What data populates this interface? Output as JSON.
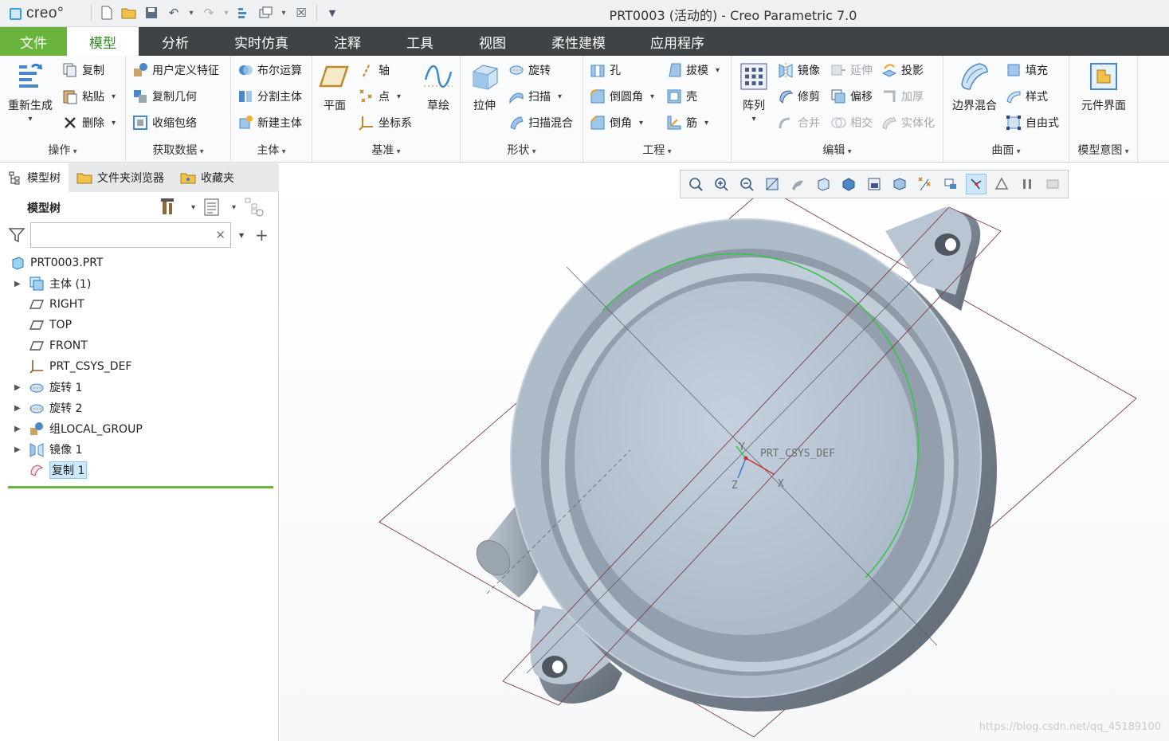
{
  "app": {
    "logo_text": "creo°",
    "window_title": "PRT0003 (活动的) - Creo Parametric 7.0"
  },
  "menu": {
    "tabs": [
      "文件",
      "模型",
      "分析",
      "实时仿真",
      "注释",
      "工具",
      "视图",
      "柔性建模",
      "应用程序"
    ],
    "active": "模型"
  },
  "ribbon": {
    "operations": {
      "label": "操作",
      "regenerate": "重新生成",
      "copy": "复制",
      "paste": "粘贴",
      "delete": "删除"
    },
    "get_data": {
      "label": "获取数据",
      "udf": "用户定义特征",
      "copy_geom": "复制几何",
      "shrinkwrap": "收缩包络"
    },
    "body": {
      "label": "主体",
      "boolean": "布尔运算",
      "split": "分割主体",
      "new_body": "新建主体"
    },
    "datum": {
      "label": "基准",
      "plane": "平面",
      "axis": "轴",
      "point": "点",
      "csys": "坐标系",
      "sketch": "草绘"
    },
    "shapes": {
      "label": "形状",
      "extrude": "拉伸",
      "revolve": "旋转",
      "sweep": "扫描",
      "swept_blend": "扫描混合"
    },
    "engineering": {
      "label": "工程",
      "hole": "孔",
      "round": "倒圆角",
      "chamfer": "倒角",
      "draft": "拔模",
      "shell": "壳",
      "rib": "筋"
    },
    "editing": {
      "label": "编辑",
      "pattern": "阵列",
      "mirror": "镜像",
      "trim": "修剪",
      "merge": "合并",
      "extend": "延伸",
      "offset": "偏移",
      "intersect": "相交",
      "project": "投影",
      "thicken": "加厚",
      "solidify": "实体化"
    },
    "surfaces": {
      "label": "曲面",
      "boundary_blend": "边界混合",
      "fill": "填充",
      "style": "样式",
      "freestyle": "自由式"
    },
    "model_intent": {
      "label": "模型意图",
      "component_interface": "元件界面"
    }
  },
  "panel": {
    "tabs": [
      "模型树",
      "文件夹浏览器",
      "收藏夹"
    ],
    "tree_header": "模型树",
    "search_value": "",
    "tree": [
      {
        "label": "PRT0003.PRT",
        "icon": "part-icon",
        "expand": false,
        "selected": false
      },
      {
        "label": "主体 (1)",
        "icon": "body-icon",
        "expand": true,
        "selected": false
      },
      {
        "label": "RIGHT",
        "icon": "datum-plane-icon",
        "expand": false,
        "selected": false
      },
      {
        "label": "TOP",
        "icon": "datum-plane-icon",
        "expand": false,
        "selected": false
      },
      {
        "label": "FRONT",
        "icon": "datum-plane-icon",
        "expand": false,
        "selected": false
      },
      {
        "label": "PRT_CSYS_DEF",
        "icon": "csys-icon",
        "expand": false,
        "selected": false
      },
      {
        "label": "旋转 1",
        "icon": "revolve-icon",
        "expand": true,
        "selected": false
      },
      {
        "label": "旋转 2",
        "icon": "revolve-icon",
        "expand": true,
        "selected": false
      },
      {
        "label": "组LOCAL_GROUP",
        "icon": "group-icon",
        "expand": true,
        "selected": false
      },
      {
        "label": "镜像 1",
        "icon": "mirror-icon",
        "expand": true,
        "selected": false
      },
      {
        "label": "复制 1",
        "icon": "copy-surface-icon",
        "expand": false,
        "selected": true
      }
    ]
  },
  "graphics": {
    "csys_label": "PRT_CSYS_DEF",
    "axis_x": "X",
    "axis_y": "Y",
    "axis_z": "Z",
    "watermark": "https://blog.csdn.net/qq_45189100"
  },
  "colors": {
    "accent_green": "#6ab43e",
    "menubar": "#3f4346",
    "model_face": "#b4c2d2",
    "model_dark": "#7e8894",
    "datum_plane": "#7a3a4a",
    "highlight_curve": "#39c44a"
  }
}
